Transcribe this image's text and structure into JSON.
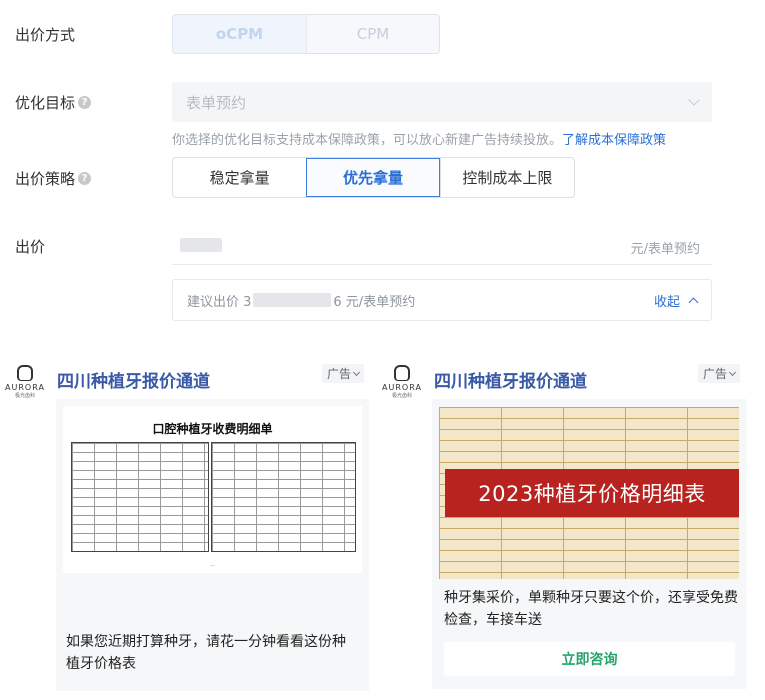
{
  "bid_method": {
    "label": "出价方式",
    "options": [
      "oCPM",
      "CPM"
    ],
    "selected": "oCPM"
  },
  "optimization": {
    "label": "优化目标",
    "value": "表单预约",
    "hint": "你选择的优化目标支持成本保障政策，可以放心新建广告持续投放。",
    "hint_link": "了解成本保障政策"
  },
  "strategy": {
    "label": "出价策略",
    "options": [
      "稳定拿量",
      "优先拿量",
      "控制成本上限"
    ],
    "selected": "优先拿量"
  },
  "bid": {
    "label": "出价",
    "unit": "元/表单预约"
  },
  "suggested": {
    "prefix": "建议出价 3",
    "suffix": "6 元/表单预约",
    "collapse": "收起"
  },
  "ads": [
    {
      "brand": "AURORA",
      "brand_sub": "极光齿科",
      "title": "四川种植牙报价通道",
      "tag": "广告",
      "image_title": "口腔种植牙收费明细单",
      "text": "如果您近期打算种牙，请花一分钟看看这份种植牙价格表"
    },
    {
      "brand": "AURORA",
      "brand_sub": "极光齿科",
      "title": "四川种植牙报价通道",
      "tag": "广告",
      "banner": "2023种植牙价格明细表",
      "text": "种牙集采价，单颗种牙只要这个价，还享受免费检查，车接车送",
      "cta": "立即咨询"
    }
  ]
}
